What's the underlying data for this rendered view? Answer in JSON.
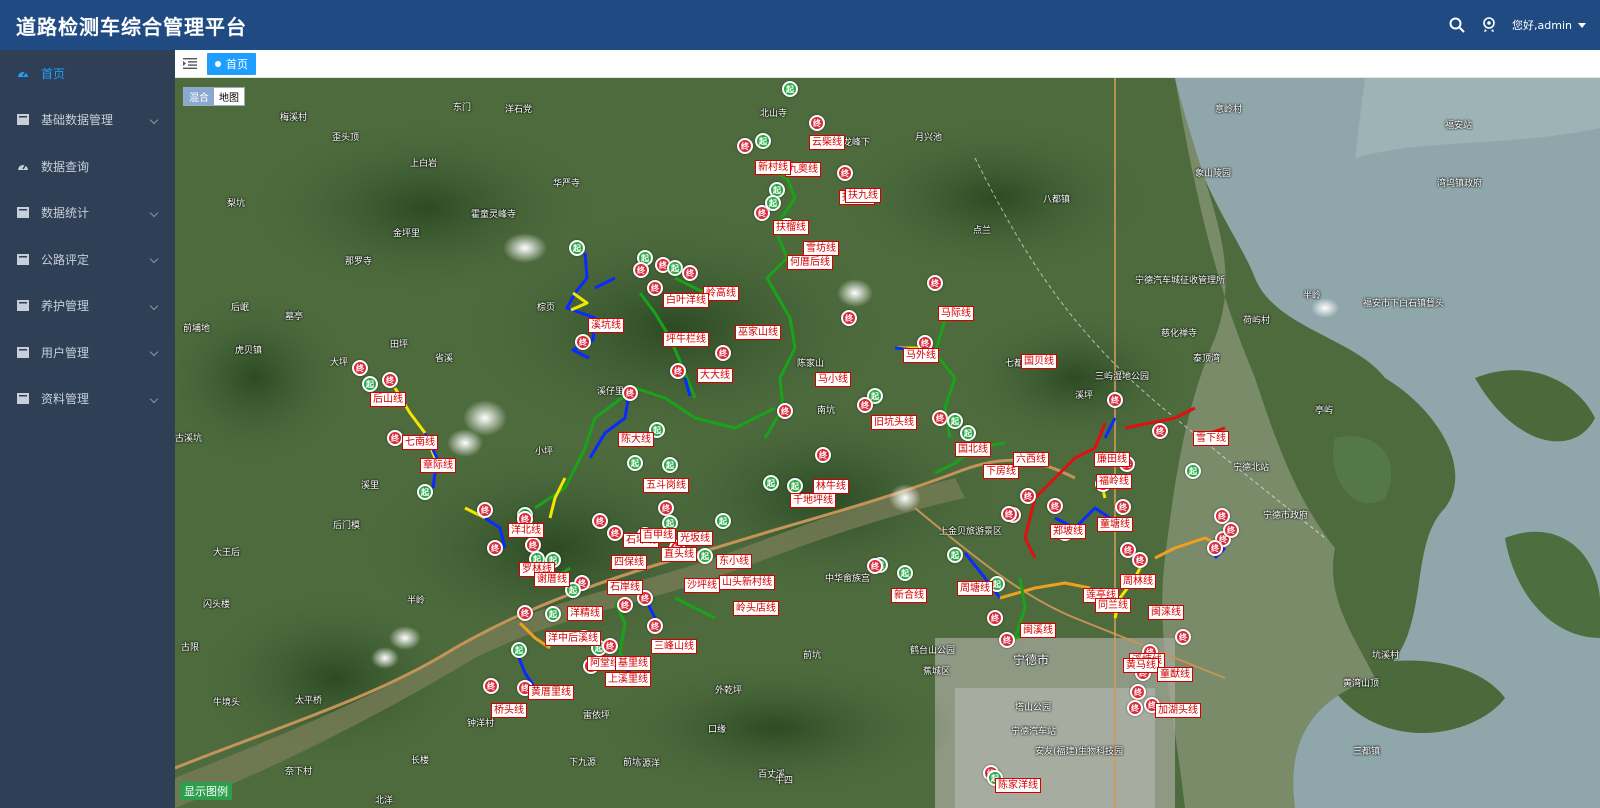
{
  "app": {
    "title": "道路检测车综合管理平台"
  },
  "header": {
    "user_greeting": "您好,admin",
    "icons": [
      "search-icon",
      "user-badge-icon"
    ]
  },
  "sidebar": {
    "items": [
      {
        "label": "首页",
        "icon": "dashboard-icon",
        "active": true
      },
      {
        "label": "基础数据管理",
        "icon": "folder-icon",
        "expandable": true
      },
      {
        "label": "数据查询",
        "icon": "dashboard-icon"
      },
      {
        "label": "数据统计",
        "icon": "folder-icon",
        "expandable": true
      },
      {
        "label": "公路评定",
        "icon": "folder-icon",
        "expandable": true
      },
      {
        "label": "养护管理",
        "icon": "folder-icon",
        "expandable": true
      },
      {
        "label": "用户管理",
        "icon": "folder-icon",
        "expandable": true
      },
      {
        "label": "资料管理",
        "icon": "folder-icon",
        "expandable": true
      }
    ]
  },
  "tabs": {
    "home_label": "首页"
  },
  "map": {
    "type_control": {
      "hybrid": "混合",
      "map": "地图"
    },
    "legend_toggle": "显示图例",
    "colors": {
      "start": "#2aa745",
      "end": "#d92a3a",
      "blue": "#0a2bff",
      "yellow": "#f2e700",
      "green": "#1aa21a",
      "red": "#e01010",
      "orange": "#f0a020"
    },
    "marker_text": {
      "start": "起",
      "end": "终"
    },
    "places": [
      "梅溪村",
      "东门",
      "洋石党",
      "北山寺",
      "龙峰下",
      "月兴池",
      "意岭村",
      "福安站",
      "歪头顶",
      "上白岩",
      "华严寺",
      "霍童灵峰寺",
      "梨坑",
      "金坪里",
      "那罗寺",
      "八都镇",
      "点兰",
      "象山陵园",
      "湾坞镇政府",
      "宁德汽车城征收管理所",
      "半岭",
      "福安市下白石镇督头",
      "前埔地",
      "虎贝镇",
      "后岷",
      "墓亭",
      "田坪",
      "大坪",
      "省溪",
      "棕页",
      "溪仔里",
      "陈家山",
      "南坑",
      "七都镇",
      "三屿湿地公园",
      "慈化禅寺",
      "泰顶湾",
      "荷屿村",
      "溪坪",
      "古溪坑",
      "小坪",
      "溪里",
      "宁德北站",
      "宁德市政府",
      "后门模",
      "大王后",
      "半岭",
      "上金贝旅游景区",
      "中华畲族宫",
      "鹤台山公园",
      "蕉城区",
      "宁德市",
      "塔山公园",
      "宁德汽车站",
      "安友(福建)生物科技园",
      "三都镇",
      "黄湾山顶",
      "坑溪村",
      "闪头楼",
      "古限",
      "太平桥",
      "牛境头",
      "钟洋村",
      "长楼",
      "下九源",
      "外乾坪",
      "前坑",
      "百丈溪",
      "牛四",
      "奈下村",
      "北洋",
      "雷依坪",
      "口缘",
      "下源洋",
      "前坑",
      "亭屿"
    ],
    "road_labels": [
      "云柴线",
      "九奥线",
      "新村线",
      "抉九线",
      "扶九线",
      "扶榴线",
      "雪坊线",
      "何厝后线",
      "岭高线",
      "白叶洋线",
      "溪坑线",
      "坪牛栏线",
      "巫家山线",
      "马小线",
      "马际线",
      "马外线",
      "大大线",
      "后山线",
      "七南线",
      "章际线",
      "陈大线",
      "国贝线",
      "雪下线",
      "旧坑头线",
      "国北线",
      "下房线",
      "六西线",
      "廉田线",
      "福岭线",
      "五斗岗线",
      "千地坪线",
      "林牛线",
      "洋北线",
      "郑坡线",
      "童塘线",
      "罗林线",
      "谢厝线",
      "四保线",
      "石岸线",
      "东小线",
      "沙坪线",
      "山头新村线",
      "岭头店线",
      "光坂线",
      "直头线",
      "洋精线",
      "洋中后溪线",
      "三峰山线",
      "阿堂线",
      "基里线",
      "上溪里线",
      "黄厝里线",
      "桥头线",
      "闽溪线",
      "陈家洋线",
      "莲亭线",
      "新合线",
      "周塘线",
      "同兰线",
      "周林线",
      "闽涞线",
      "溪塘线",
      "黄马线",
      "童猷线",
      "加湖头线",
      "石坪线",
      "百甲线"
    ]
  }
}
